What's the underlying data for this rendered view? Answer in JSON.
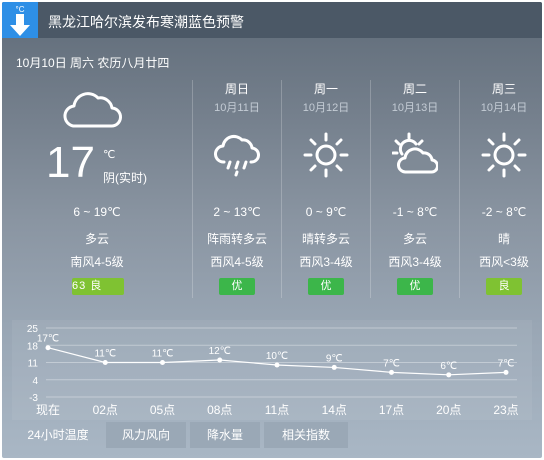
{
  "alert": {
    "icon_unit": "°C",
    "icon": "arrow-down-icon",
    "text": "黑龙江哈尔滨发布寒潮蓝色预警"
  },
  "date_line": "10月10日 周六 农历八月廿四",
  "today": {
    "icon": "cloud-icon",
    "temp": "17",
    "unit": "℃",
    "condition": "阴(实时)",
    "range": "6 ~ 19℃",
    "weather": "多云",
    "wind": "南风4-5级",
    "aqi": "63 良"
  },
  "forecast": [
    {
      "day": "周日",
      "date": "10月11日",
      "icon": "rain-cloud-icon",
      "range": "2 ~ 13℃",
      "weather": "阵雨转多云",
      "wind": "西风4-5级",
      "aqi": "优"
    },
    {
      "day": "周一",
      "date": "10月12日",
      "icon": "sun-icon",
      "range": "0 ~ 9℃",
      "weather": "晴转多云",
      "wind": "西风3-4级",
      "aqi": "优"
    },
    {
      "day": "周二",
      "date": "10月13日",
      "icon": "sun-cloud-icon",
      "range": "-1 ~ 8℃",
      "weather": "多云",
      "wind": "西风3-4级",
      "aqi": "优"
    },
    {
      "day": "周三",
      "date": "10月14日",
      "icon": "sun-icon",
      "range": "-2 ~ 8℃",
      "weather": "晴",
      "wind": "西风<3级",
      "aqi": "良"
    }
  ],
  "colors": {
    "aqi_excellent": "#3cb64a",
    "aqi_good": "#7fc232",
    "alert_blue": "#2e8fe6"
  },
  "chart_data": {
    "type": "line",
    "categories": [
      "现在",
      "02点",
      "05点",
      "08点",
      "11点",
      "14点",
      "17点",
      "20点",
      "23点"
    ],
    "values": [
      17,
      11,
      11,
      12,
      10,
      9,
      7,
      6,
      7
    ],
    "data_labels": [
      "17℃",
      "11℃",
      "11℃",
      "12℃",
      "10℃",
      "9℃",
      "7℃",
      "6℃",
      "7℃"
    ],
    "yticks": [
      25,
      18,
      11,
      4,
      -3
    ],
    "ylim": [
      -3,
      25
    ],
    "grid": true
  },
  "tabs": [
    "24小时温度",
    "风力风向",
    "降水量",
    "相关指数"
  ]
}
